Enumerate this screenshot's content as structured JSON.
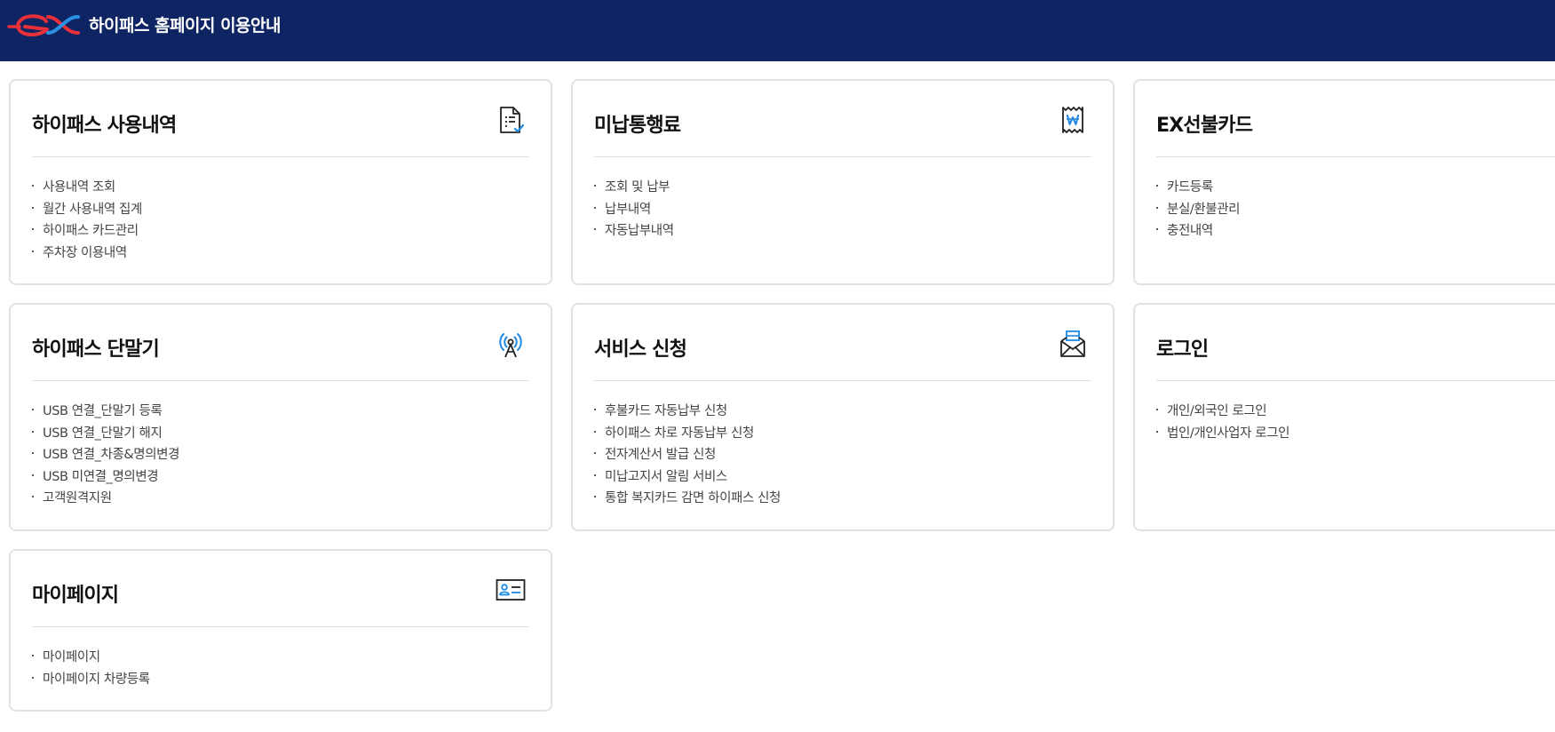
{
  "header": {
    "title": "하이패스 홈페이지 이용안내"
  },
  "colors": {
    "header_bg": "#0f2462",
    "logo_red": "#e8303a",
    "logo_blue": "#2b8fe3",
    "icon_accent": "#1e88e5",
    "card_border": "#dfe3e8"
  },
  "cards": [
    {
      "title": "하이패스 사용내역",
      "icon": "document-check-icon",
      "items": [
        "사용내역 조회",
        "월간 사용내역 집계",
        "하이패스 카드관리",
        "주차장 이용내역"
      ]
    },
    {
      "title": "미납통행료",
      "icon": "won-receipt-icon",
      "items": [
        "조회 및 납부",
        "납부내역",
        "자동납부내역"
      ]
    },
    {
      "title": "EX선불카드",
      "icon": "",
      "items": [
        "카드등록",
        "분실/환불관리",
        "충전내역"
      ]
    },
    {
      "title": "하이패스 단말기",
      "icon": "antenna-icon",
      "items": [
        "USB 연결_단말기 등록",
        "USB 연결_단말기 해지",
        "USB 연결_차종&명의변경",
        "USB 미연결_명의변경",
        "고객원격지원"
      ]
    },
    {
      "title": "서비스 신청",
      "icon": "mail-open-icon",
      "items": [
        "후불카드 자동납부 신청",
        "하이패스 차로 자동납부 신청",
        "전자계산서 발급 신청",
        "미납고지서 알림 서비스",
        "통합 복지카드 감면 하이패스 신청"
      ]
    },
    {
      "title": "로그인",
      "icon": "",
      "items": [
        "개인/외국인 로그인",
        "법인/개인사업자 로그인"
      ]
    },
    {
      "title": "마이페이지",
      "icon": "id-card-icon",
      "items": [
        "마이페이지",
        "마이페이지 차량등록"
      ]
    }
  ]
}
